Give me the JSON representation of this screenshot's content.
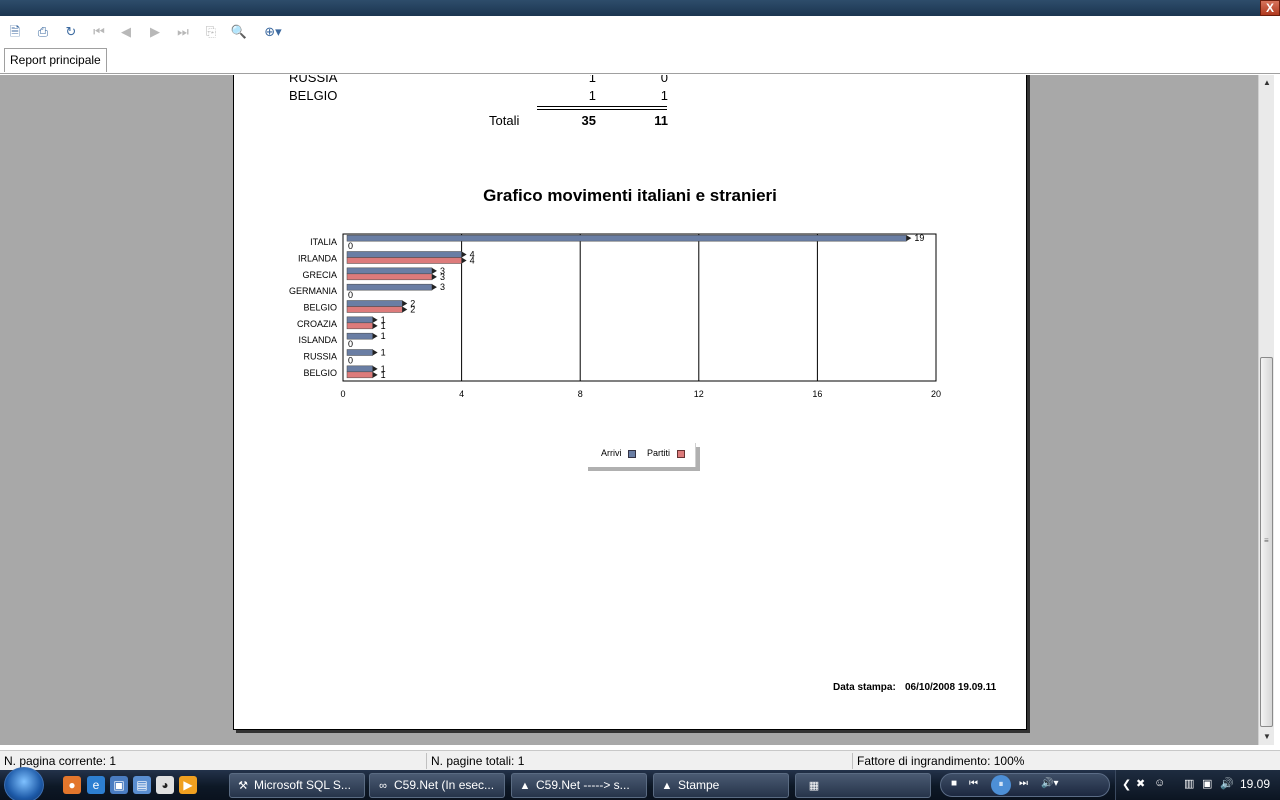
{
  "window": {
    "close_label": "X"
  },
  "toolbar": {
    "icons": [
      "export-icon",
      "print-icon",
      "refresh-icon",
      "first-page-icon",
      "prev-page-icon",
      "next-page-icon",
      "last-page-icon",
      "goto-page-icon",
      "find-icon",
      "zoom-icon"
    ]
  },
  "tabs": [
    {
      "label": "Report principale"
    }
  ],
  "report": {
    "rows": [
      {
        "country": "RUSSIA",
        "arrivi": "1",
        "partiti": "0"
      },
      {
        "country": "BELGIO",
        "arrivi": "1",
        "partiti": "1"
      }
    ],
    "totals_label": "Totali",
    "totals_arrivi": "35",
    "totals_partiti": "11",
    "chart_title": "Grafico movimenti italiani e stranieri",
    "print_date_label": "Data stampa:",
    "print_date_value": "06/10/2008 19.09.11"
  },
  "chart_data": {
    "type": "bar",
    "orientation": "horizontal",
    "title": "Grafico movimenti italiani e stranieri",
    "categories": [
      "ITALIA",
      "IRLANDA",
      "GRECIA",
      "GERMANIA",
      "BELGIO",
      "CROAZIA",
      "ISLANDA",
      "RUSSIA",
      "BELGIO"
    ],
    "series": [
      {
        "name": "Arrivi",
        "color": "#6a7ea4",
        "values": [
          19,
          4,
          3,
          3,
          2,
          1,
          1,
          1,
          1
        ]
      },
      {
        "name": "Partiti",
        "color": "#dd7b7b",
        "values": [
          0,
          4,
          3,
          0,
          2,
          1,
          0,
          0,
          1
        ]
      }
    ],
    "xlim": [
      0,
      20
    ],
    "xticks": [
      "0",
      "4",
      "8",
      "12",
      "16",
      "20"
    ],
    "grid": true,
    "legend": "bottom-center"
  },
  "status": {
    "current_page": "N. pagina corrente: 1",
    "total_pages": "N. pagine totali: 1",
    "zoom": "Fattore di ingrandimento: 100%"
  },
  "taskbar": {
    "items": [
      {
        "label": "Microsoft SQL S...",
        "icon": "sql-icon"
      },
      {
        "label": "C59.Net (In esec...",
        "icon": "vs-icon"
      },
      {
        "label": "C59.Net -----> s...",
        "icon": "app-icon"
      },
      {
        "label": "Stampe",
        "icon": "app-icon"
      }
    ],
    "clock": "19.09"
  }
}
